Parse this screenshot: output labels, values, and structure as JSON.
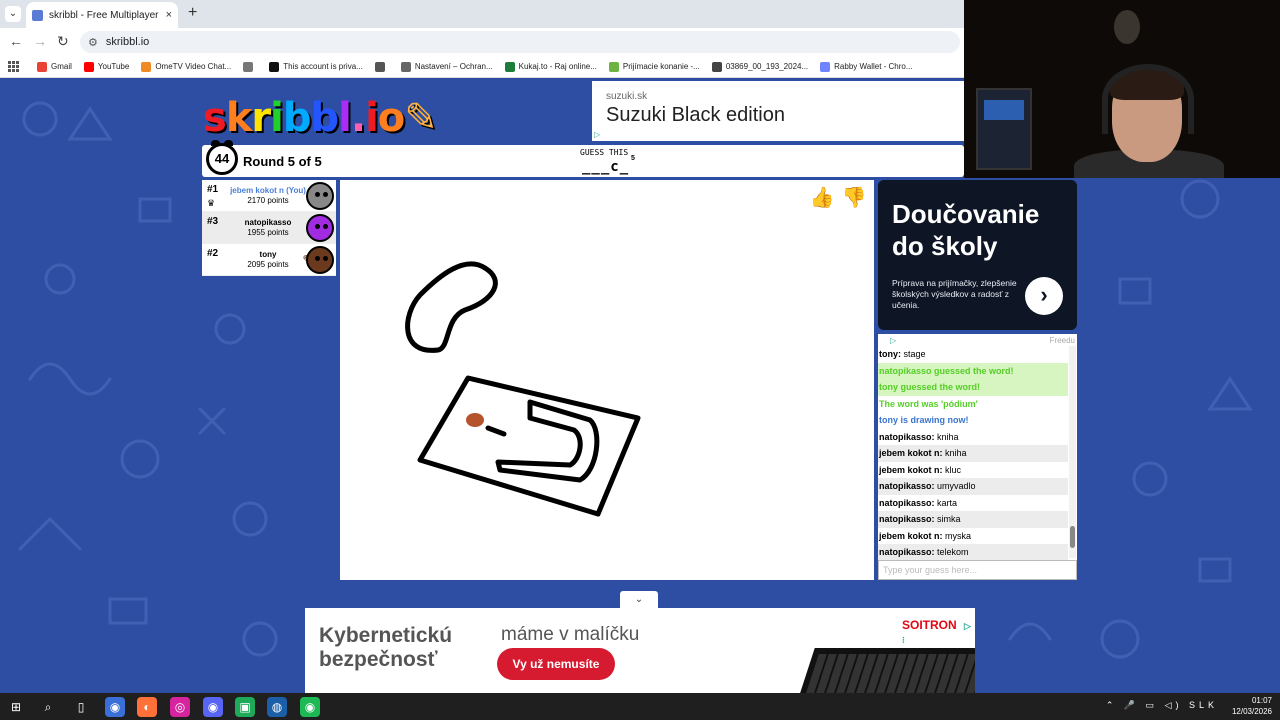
{
  "browser": {
    "tab_title": "skribbl - Free Multiplayer Drawi",
    "tab_close": "×",
    "new_tab": "+",
    "url": "skribbl.io",
    "bookmarks": [
      {
        "label": "Gmail",
        "color": "#ea4335"
      },
      {
        "label": "YouTube",
        "color": "#ff0000"
      },
      {
        "label": "OmeTV Video Chat...",
        "color": "#f08a24"
      },
      {
        "label": "",
        "color": "#777777"
      },
      {
        "label": "This account is priva...",
        "color": "#111111"
      },
      {
        "label": "",
        "color": "#555555"
      },
      {
        "label": "Nastavení – Ochran...",
        "color": "#666666"
      },
      {
        "label": "Kukaj.to - Raj online...",
        "color": "#1e7d3a"
      },
      {
        "label": "Prijímacie konanie -...",
        "color": "#6cb33f"
      },
      {
        "label": "03869_00_193_2024...",
        "color": "#444444"
      },
      {
        "label": "Rabby Wallet - Chro...",
        "color": "#7084ff"
      }
    ]
  },
  "logo": {
    "letters": [
      {
        "ch": "s",
        "color": "#ef1b24"
      },
      {
        "ch": "k",
        "color": "#ff7f1f"
      },
      {
        "ch": "r",
        "color": "#ffe400"
      },
      {
        "ch": "i",
        "color": "#22d02b"
      },
      {
        "ch": "b",
        "color": "#00aaff"
      },
      {
        "ch": "b",
        "color": "#2356ff"
      },
      {
        "ch": "l",
        "color": "#a92cf7"
      },
      {
        "ch": ".",
        "color": "#ff5fb3"
      },
      {
        "ch": "i",
        "color": "#ef1b24"
      },
      {
        "ch": "o",
        "color": "#ff7f1f"
      },
      {
        "ch": "✎",
        "color": "#ffb23f"
      }
    ]
  },
  "top_ad": {
    "domain": "suzuki.sk",
    "headline": "Suzuki Black edition",
    "badge": "▷"
  },
  "game": {
    "timer": "44",
    "round": "Round 5 of 5",
    "guess_label": "GUESS THIS",
    "word_hint": "___c_",
    "word_length": "5"
  },
  "players": [
    {
      "rank": "#1",
      "name": "jebem kokot n (You)",
      "points": "2170 points",
      "is_you": true,
      "crown": "♛",
      "avatar_color": "#888888"
    },
    {
      "rank": "#3",
      "name": "natopikasso",
      "points": "1955 points",
      "is_you": false,
      "crown": "",
      "avatar_color": "#a12be0"
    },
    {
      "rank": "#2",
      "name": "tony",
      "points": "2095 points",
      "is_you": false,
      "crown": "",
      "avatar_color": "#6b3a1e",
      "drawing": true
    }
  ],
  "canvas": {
    "thumbs_up": "👍",
    "thumbs_down": "👎",
    "stroke_color": "#000000",
    "fill_color": "#b5532d"
  },
  "side_ad": {
    "headline_1": "Doučovanie",
    "headline_2": "do školy",
    "body": "Príprava na prijímačky, zlepšenie školských výsledkov a radosť z učenia.",
    "arrow": "›",
    "footer": "Freedu",
    "badge": "▷"
  },
  "chat": {
    "messages": [
      {
        "kind": "normal",
        "alt": false,
        "name": "tony",
        "text": "stage"
      },
      {
        "kind": "green",
        "alt": false,
        "name": "",
        "text": "natopikasso guessed the word!"
      },
      {
        "kind": "green",
        "alt": false,
        "name": "",
        "text": "tony guessed the word!"
      },
      {
        "kind": "green2",
        "alt": false,
        "name": "",
        "text": "The word was 'pódium'"
      },
      {
        "kind": "blue",
        "alt": false,
        "name": "",
        "text": "tony is drawing now!"
      },
      {
        "kind": "normal",
        "alt": false,
        "name": "natopikasso",
        "text": "kniha"
      },
      {
        "kind": "normal",
        "alt": true,
        "name": "jebem kokot n",
        "text": "kniha"
      },
      {
        "kind": "normal",
        "alt": false,
        "name": "jebem kokot n",
        "text": "kluc"
      },
      {
        "kind": "normal",
        "alt": true,
        "name": "natopikasso",
        "text": "umyvadlo"
      },
      {
        "kind": "normal",
        "alt": false,
        "name": "natopikasso",
        "text": "karta"
      },
      {
        "kind": "normal",
        "alt": true,
        "name": "natopikasso",
        "text": "simka"
      },
      {
        "kind": "normal",
        "alt": false,
        "name": "jebem kokot n",
        "text": "myska"
      },
      {
        "kind": "normal",
        "alt": true,
        "name": "natopikasso",
        "text": "telekom"
      }
    ],
    "input_placeholder": "Type your guess here..."
  },
  "bottom_ad": {
    "headline_1": "Kybernetickú",
    "headline_2": "bezpečnosť",
    "tagline": "máme v malíčku",
    "cta": "Vy už nemusíte",
    "brand": "SOITRON",
    "badge": "▷ ⁝"
  },
  "taskbar": {
    "lang": "SLK",
    "time": "01:07",
    "date": "12/03/2026",
    "apps": [
      {
        "name": "windows-start-icon",
        "glyph": "⊞",
        "color": "transparent"
      },
      {
        "name": "search-icon",
        "glyph": "⌕",
        "color": "transparent"
      },
      {
        "name": "file-icon",
        "glyph": "▯",
        "color": "transparent"
      },
      {
        "name": "chrome-icon",
        "glyph": "◉",
        "color": "#3b6fd8"
      },
      {
        "name": "firefox-icon",
        "glyph": "◐",
        "color": "#ff7139"
      },
      {
        "name": "instagram-icon",
        "glyph": "◎",
        "color": "#d6249f"
      },
      {
        "name": "discord-icon",
        "glyph": "◉",
        "color": "#5865f2"
      },
      {
        "name": "chat-app-icon",
        "glyph": "▣",
        "color": "#1faa59"
      },
      {
        "name": "steam-icon",
        "glyph": "◍",
        "color": "#1b5fa8"
      },
      {
        "name": "spotify-icon",
        "glyph": "◉",
        "color": "#1db954"
      }
    ]
  }
}
